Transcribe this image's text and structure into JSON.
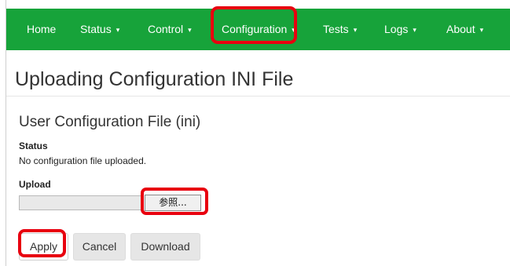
{
  "nav": {
    "items": [
      {
        "label": "Home",
        "has_dropdown": false
      },
      {
        "label": "Status",
        "has_dropdown": true
      },
      {
        "label": "Control",
        "has_dropdown": true
      },
      {
        "label": "Configuration",
        "has_dropdown": true,
        "highlighted": true
      },
      {
        "label": "Tests",
        "has_dropdown": true
      },
      {
        "label": "Logs",
        "has_dropdown": true
      },
      {
        "label": "About",
        "has_dropdown": true
      }
    ],
    "caret_glyph": "▾",
    "background_color": "#17a33a"
  },
  "page": {
    "title": "Uploading Configuration INI File"
  },
  "section": {
    "title": "User Configuration File (ini)",
    "status_label": "Status",
    "status_text": "No configuration file uploaded.",
    "upload_label": "Upload",
    "file_value": "",
    "browse_label": "参照..."
  },
  "actions": {
    "apply_label": "Apply",
    "cancel_label": "Cancel",
    "download_label": "Download"
  },
  "annotation": {
    "highlight_color": "#e8000f"
  }
}
